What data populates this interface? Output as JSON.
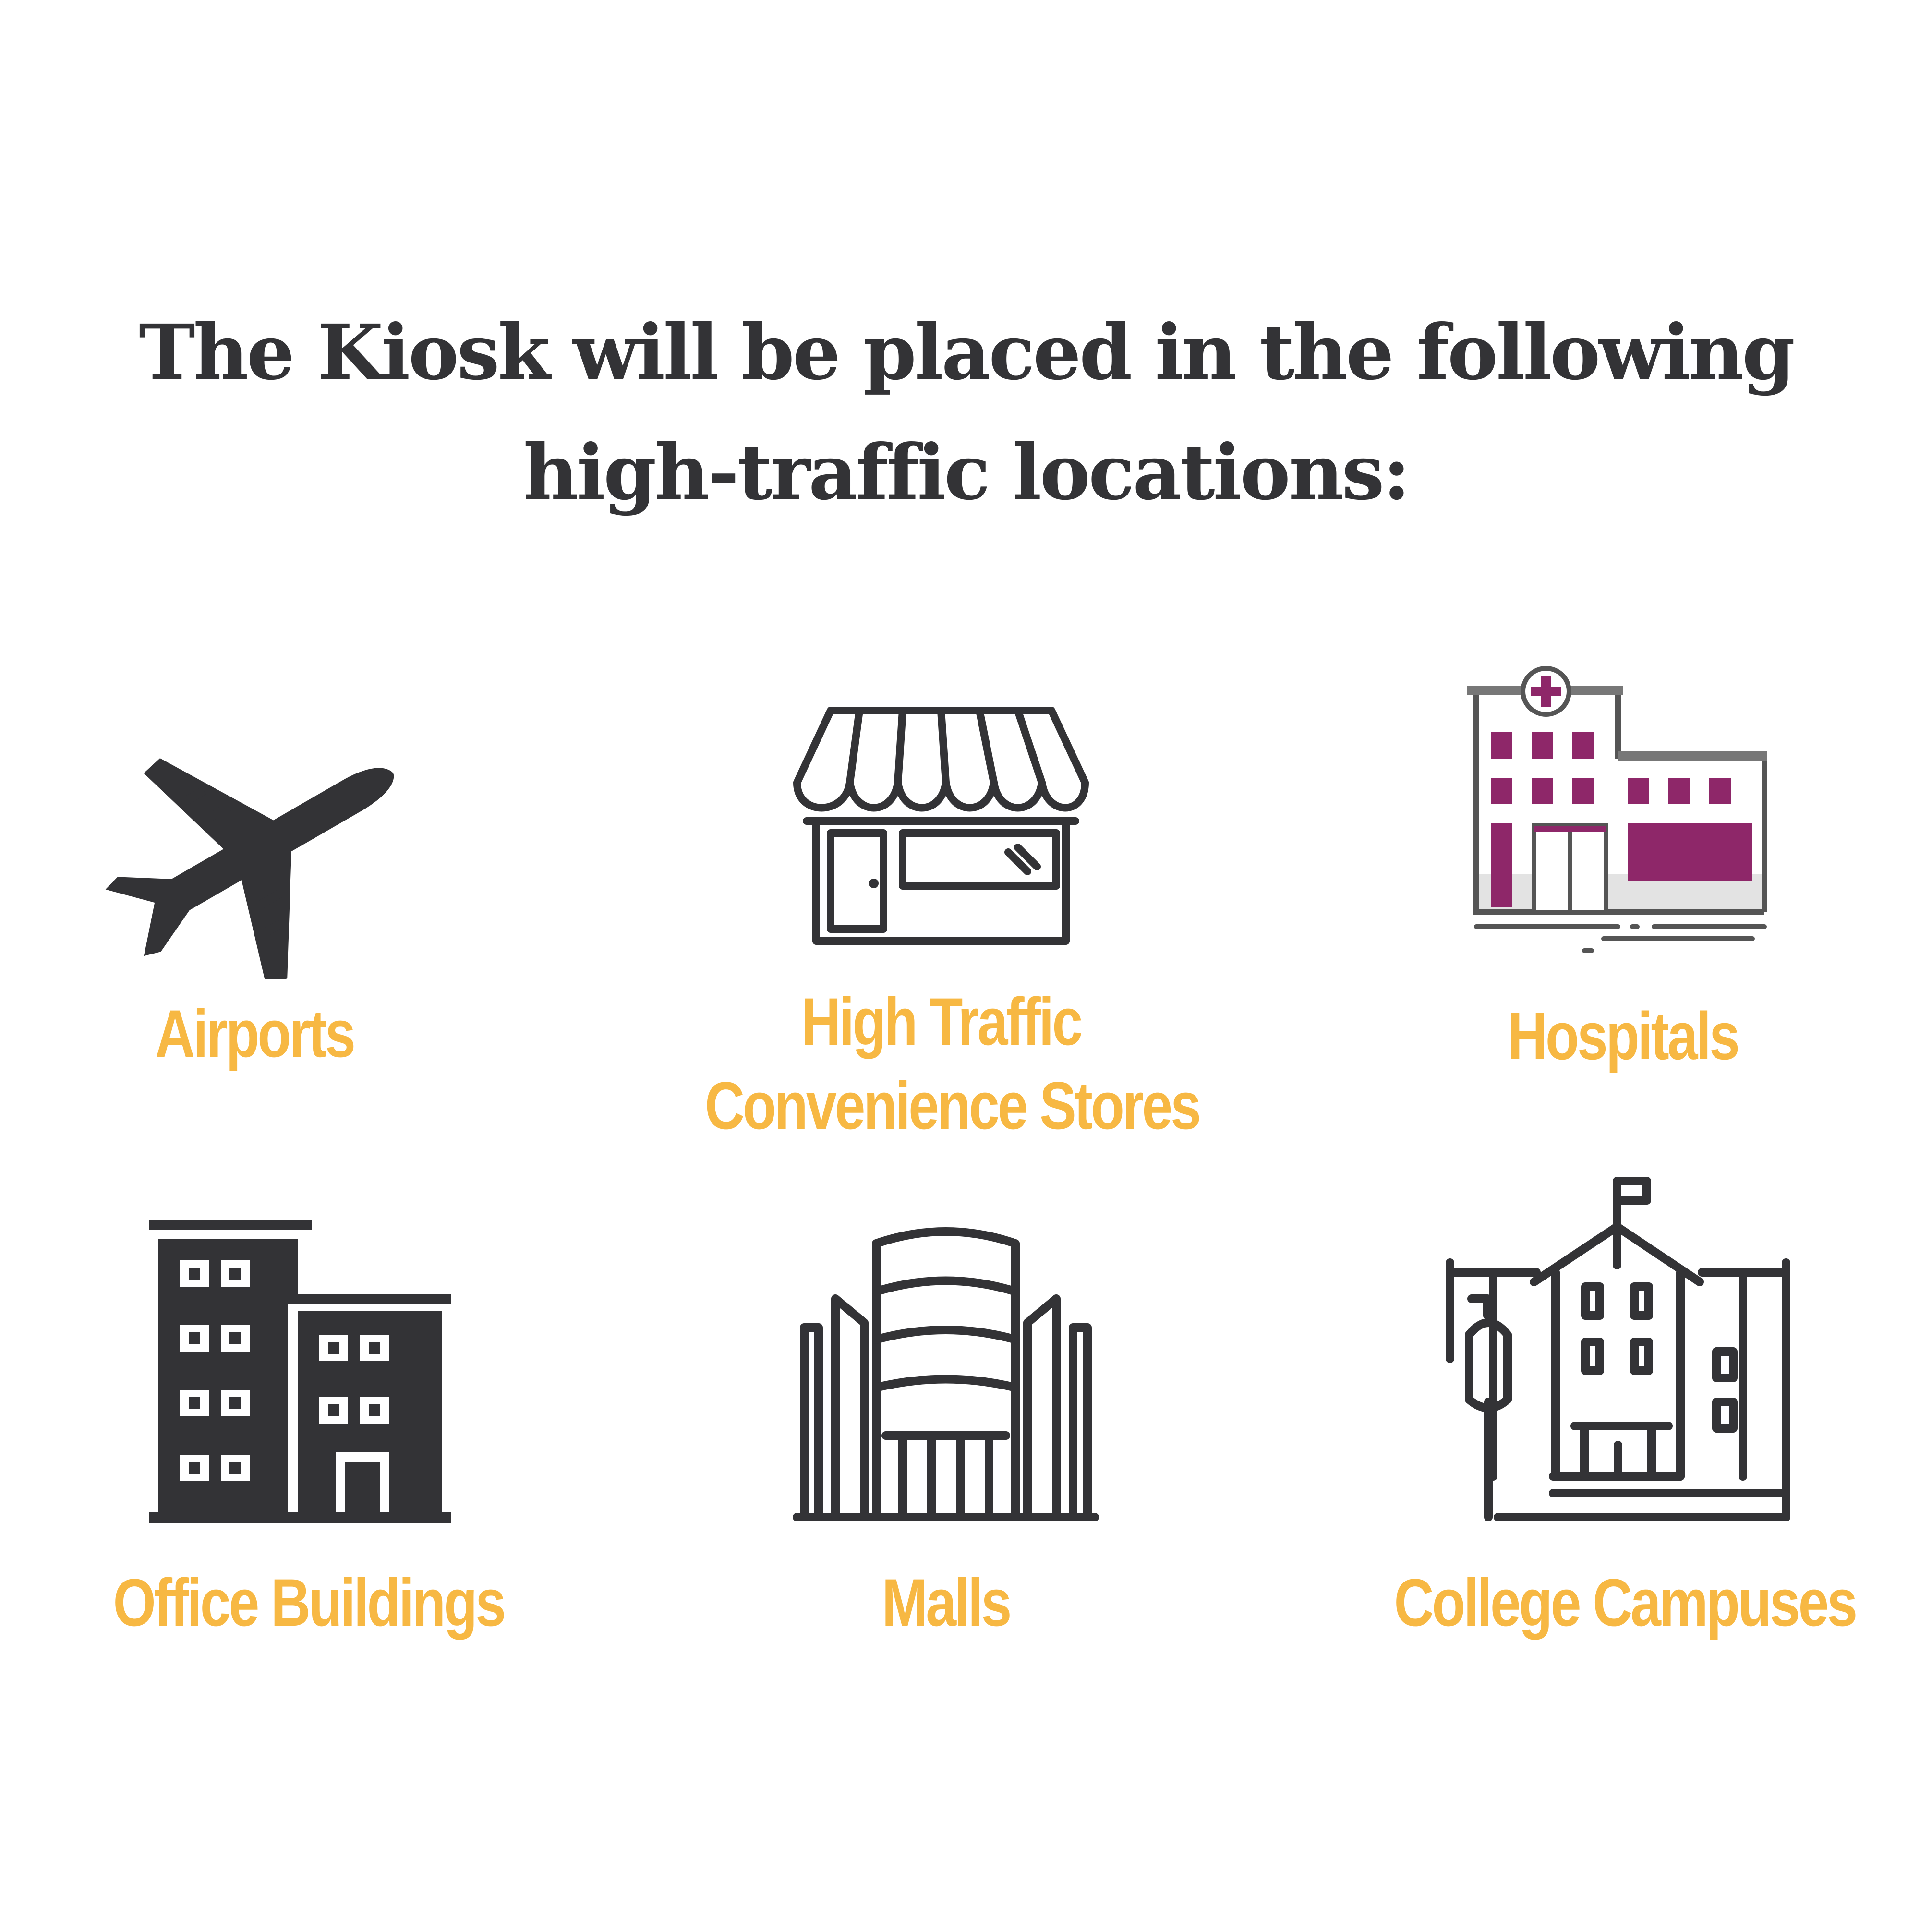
{
  "heading": {
    "line1": "The Kiosk will be placed in the following",
    "line2": "high-traffic locations:"
  },
  "colors": {
    "heading": "#333336",
    "label": "#F7B843",
    "icon": "#333336",
    "hospital_accent": "#8E2769"
  },
  "locations": [
    {
      "icon": "airplane-icon",
      "label": "Airports"
    },
    {
      "icon": "storefront-icon",
      "label_line1": "High Traffic",
      "label_line2": "Convenience Stores"
    },
    {
      "icon": "hospital-icon",
      "label": "Hospitals"
    },
    {
      "icon": "office-buildings-icon",
      "label": "Office Buildings"
    },
    {
      "icon": "mall-icon",
      "label": "Malls"
    },
    {
      "icon": "college-campus-icon",
      "label": "College Campuses"
    }
  ]
}
